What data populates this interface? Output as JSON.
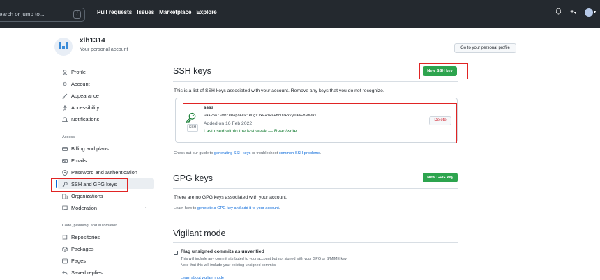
{
  "header": {
    "search_placeholder": "earch or jump to...",
    "search_shortcut": "/",
    "nav": [
      "Pull requests",
      "Issues",
      "Marketplace",
      "Explore"
    ],
    "icons": [
      "bell-icon",
      "plus-icon",
      "avatar"
    ]
  },
  "account": {
    "name": "xlh1314",
    "subtitle": "Your personal account",
    "profile_button": "Go to your personal profile"
  },
  "sidebar": {
    "items_top": [
      "Profile",
      "Account",
      "Appearance",
      "Accessibility",
      "Notifications"
    ],
    "access_heading": "Access",
    "access_items": [
      "Billing and plans",
      "Emails",
      "Password and authentication",
      "SSH and GPG keys",
      "Organizations",
      "Moderation"
    ],
    "code_heading": "Code, planning, and automation",
    "code_items": [
      "Repositories",
      "Packages",
      "Pages",
      "Saved replies"
    ]
  },
  "ssh": {
    "title": "SSH keys",
    "new_button": "New SSH key",
    "description": "This is a list of SSH keys associated with your account. Remove any keys that you do not recognize.",
    "key": {
      "name": "ssss",
      "fingerprint": "SHA256:Svmt8BApoFKP1BDgxIxE+1ws+nqD2EY7yu4AEhHmvRI",
      "added": "Added on 16 Feb 2022",
      "last_used": "Last used within the last week — Read/write",
      "badge": "SSH",
      "delete": "Delete"
    },
    "guide_prefix": "Check out our guide to ",
    "guide_link1": "generating SSH keys",
    "guide_mid": " or troubleshoot ",
    "guide_link2": "common SSH problems",
    "guide_suffix": "."
  },
  "gpg": {
    "title": "GPG keys",
    "new_button": "New GPG key",
    "empty": "There are no GPG keys associated with your account.",
    "learn_prefix": "Learn how to ",
    "learn_link": "generate a GPG key and add it to your account",
    "learn_suffix": "."
  },
  "vigilant": {
    "title": "Vigilant mode",
    "checkbox_label": "Flag unsigned commits as unverified",
    "desc1": "This will include any commit attributed to your account but not signed with your GPG or S/MIME key.",
    "desc2": "Note that this will include your existing unsigned commits.",
    "learn_link": "Learn about vigilant mode"
  },
  "colors": {
    "header_bg": "#24292f",
    "primary_green": "#2da44e",
    "link_blue": "#0969da",
    "annotation_red": "#e02424"
  }
}
